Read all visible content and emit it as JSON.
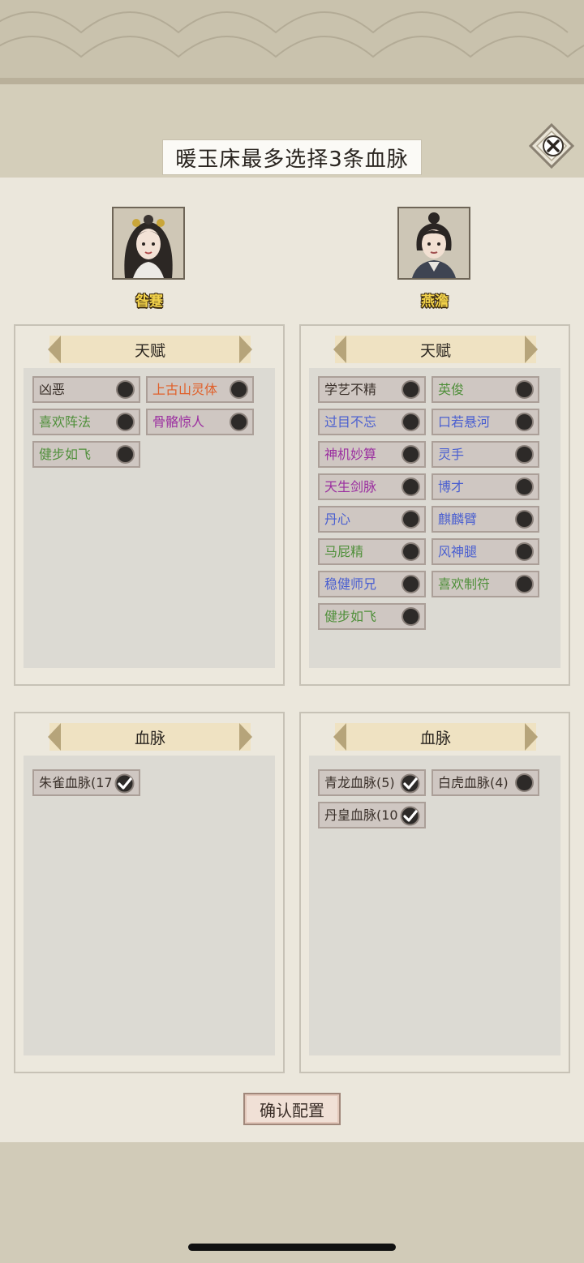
{
  "dialog": {
    "title": "暖玉床最多选择3条血脉"
  },
  "colors": {
    "white": "#3a302a",
    "green": "#4f8f3a",
    "blue": "#4a5fd0",
    "purple": "#9b2fa0",
    "orange": "#e0602a"
  },
  "characters": [
    {
      "name": "昝蹇",
      "talent_label": "天赋",
      "bloodline_label": "血脉",
      "talents": [
        {
          "label": "凶恶",
          "color": "#3a302a"
        },
        {
          "label": "上古山灵体",
          "color": "#e0602a"
        },
        {
          "label": "喜欢阵法",
          "color": "#4f8f3a"
        },
        {
          "label": "骨骼惊人",
          "color": "#9b2fa0"
        },
        {
          "label": "健步如飞",
          "color": "#4f8f3a"
        }
      ],
      "bloodlines": [
        {
          "label": "朱雀血脉(17",
          "checked": true
        }
      ]
    },
    {
      "name": "燕澹",
      "talent_label": "天赋",
      "bloodline_label": "血脉",
      "talents": [
        {
          "label": "学艺不精",
          "color": "#3a302a"
        },
        {
          "label": "英俊",
          "color": "#4f8f3a"
        },
        {
          "label": "过目不忘",
          "color": "#4a5fd0"
        },
        {
          "label": "口若悬河",
          "color": "#4a5fd0"
        },
        {
          "label": "神机妙算",
          "color": "#9b2fa0"
        },
        {
          "label": "灵手",
          "color": "#4a5fd0"
        },
        {
          "label": "天生剑脉",
          "color": "#9b2fa0"
        },
        {
          "label": "博才",
          "color": "#4a5fd0"
        },
        {
          "label": "丹心",
          "color": "#4a5fd0"
        },
        {
          "label": "麒麟臂",
          "color": "#4a5fd0"
        },
        {
          "label": "马屁精",
          "color": "#4f8f3a"
        },
        {
          "label": "风神腿",
          "color": "#4a5fd0"
        },
        {
          "label": "稳健师兄",
          "color": "#4a5fd0"
        },
        {
          "label": "喜欢制符",
          "color": "#4f8f3a"
        },
        {
          "label": "健步如飞",
          "color": "#4f8f3a"
        }
      ],
      "bloodlines": [
        {
          "label": "青龙血脉(5)",
          "checked": true
        },
        {
          "label": "白虎血脉(4)",
          "checked": false
        },
        {
          "label": "丹皇血脉(10",
          "checked": true
        }
      ]
    }
  ],
  "buttons": {
    "confirm": "确认配置",
    "close_icon": "close-icon"
  }
}
